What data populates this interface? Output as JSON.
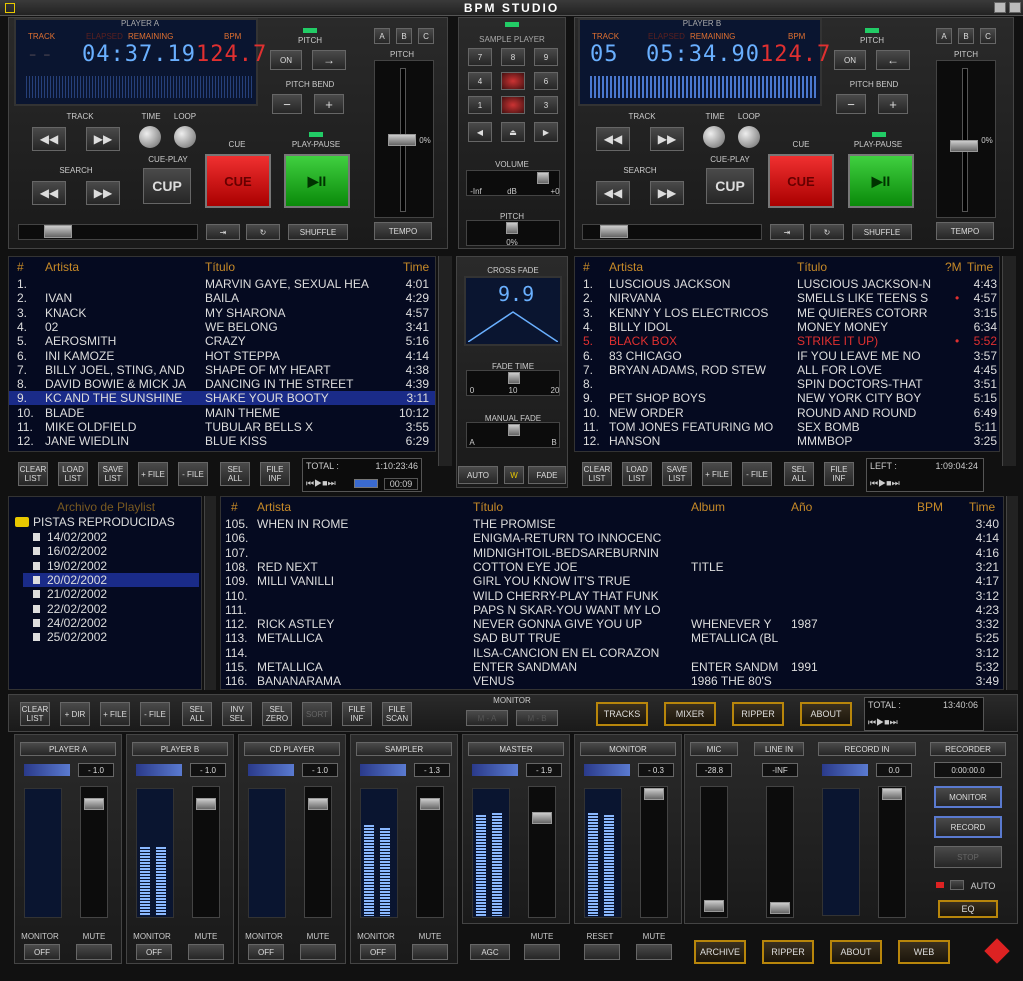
{
  "app": {
    "title": "BPM STUDIO"
  },
  "deckA": {
    "label": "PLAYER A",
    "track_lbl": "TRACK",
    "elapsed_lbl": "ELAPSED",
    "remaining_lbl": "REMAINING",
    "bpm_lbl": "BPM",
    "track_num": "--",
    "time": "04:37.19",
    "bpm": "124.7",
    "pitch_lbl": "PITCH",
    "on": "ON",
    "arrow": "→",
    "pitchbend_lbl": "PITCH BEND",
    "minus": "−",
    "plus": "+",
    "track": "TRACK",
    "time_lbl": "TIME",
    "loop_lbl": "LOOP",
    "search": "SEARCH",
    "cueplay": "CUE-PLAY",
    "cup": "CUP",
    "cue_lbl": "CUE",
    "cue": "CUE",
    "playpause_lbl": "PLAY-PAUSE",
    "playpause": "▶II",
    "pitch_pct": "0%",
    "shuffle": "SHUFFLE",
    "tempo": "TEMPO",
    "a": "A",
    "b": "B",
    "c": "C",
    "pitch_head": "PITCH"
  },
  "deckB": {
    "label": "PLAYER B",
    "track_lbl": "TRACK",
    "elapsed_lbl": "ELAPSED",
    "remaining_lbl": "REMAINING",
    "bpm_lbl": "BPM",
    "track_num": "05",
    "time": "05:34.90",
    "bpm": "124.7",
    "pitch_lbl": "PITCH",
    "on": "ON",
    "arrow": "←",
    "pitchbend_lbl": "PITCH BEND",
    "minus": "−",
    "plus": "+",
    "track": "TRACK",
    "time_lbl": "TIME",
    "loop_lbl": "LOOP",
    "search": "SEARCH",
    "cueplay": "CUE-PLAY",
    "cup": "CUP",
    "cue_lbl": "CUE",
    "cue": "CUE",
    "playpause_lbl": "PLAY-PAUSE",
    "playpause": "▶II",
    "pitch_pct": "0%",
    "shuffle": "SHUFFLE",
    "tempo": "TEMPO",
    "a": "A",
    "b": "B",
    "c": "C",
    "pitch_head": "PITCH"
  },
  "sampler": {
    "label": "SAMPLE PLAYER",
    "pads": [
      "7",
      "8",
      "9",
      "4",
      "",
      "6",
      "1",
      "",
      "3"
    ],
    "volume": "VOLUME",
    "inf": "-Inf",
    "db": "dB",
    "zero": "+0",
    "pitch": "PITCH",
    "pct": "0%"
  },
  "crossfade": {
    "label": "CROSS FADE",
    "value": "9.9",
    "fadetime": "FADE TIME",
    "t0": "0",
    "t10": "10",
    "t20": "20",
    "manual": "MANUAL FADE",
    "a": "A",
    "b": "B",
    "auto": "AUTO",
    "w": "W",
    "fade": "FADE"
  },
  "listA": {
    "cols": [
      "#",
      "Artista",
      "Título",
      "Time"
    ],
    "rows": [
      [
        "1.",
        "",
        "MARVIN GAYE, SEXUAL HEA",
        "4:01"
      ],
      [
        "2.",
        "IVAN",
        "BAILA",
        "4:29"
      ],
      [
        "3.",
        "KNACK",
        "MY SHARONA",
        "4:57"
      ],
      [
        "4.",
        "02",
        "WE BELONG",
        "3:41"
      ],
      [
        "5.",
        "AEROSMITH",
        "CRAZY",
        "5:16"
      ],
      [
        "6.",
        "INI KAMOZE",
        "HOT STEPPA",
        "4:14"
      ],
      [
        "7.",
        "BILLY JOEL, STING, AND",
        "SHAPE OF MY HEART",
        "4:38"
      ],
      [
        "8.",
        "DAVID BOWIE & MICK JA",
        "DANCING IN THE STREET",
        "4:39"
      ],
      [
        "9.",
        "KC AND THE SUNSHINE",
        "SHAKE YOUR BOOTY",
        "3:11"
      ],
      [
        "10.",
        "BLADE",
        "MAIN THEME",
        "10:12"
      ],
      [
        "11.",
        "MIKE OLDFIELD",
        "TUBULAR BELLS X",
        "3:55"
      ],
      [
        "12.",
        "JANE WIEDLIN",
        "BLUE KISS",
        "6:29"
      ]
    ],
    "total_lbl": "TOTAL :",
    "total": "1:10:23:46",
    "pos": "00:09"
  },
  "listB": {
    "cols": [
      "#",
      "Artista",
      "Título",
      "?M",
      "Time"
    ],
    "rows": [
      [
        "1.",
        "LUSCIOUS JACKSON",
        "LUSCIOUS JACKSON-N",
        "",
        "4:43"
      ],
      [
        "2.",
        "NIRVANA",
        "SMELLS LIKE TEENS S",
        "•",
        "4:57"
      ],
      [
        "3.",
        "KENNY Y LOS ELECTRICOS",
        "ME QUIERES COTORR",
        "",
        "3:15"
      ],
      [
        "4.",
        "BILLY IDOL",
        "MONEY MONEY",
        "",
        "6:34"
      ],
      [
        "5.",
        "BLACK BOX",
        "STRIKE IT UP)",
        "•",
        "5:52"
      ],
      [
        "6.",
        "83 CHICAGO",
        "IF YOU LEAVE ME NO",
        "",
        "3:57"
      ],
      [
        "7.",
        "BRYAN ADAMS, ROD STEW",
        "ALL FOR LOVE",
        "",
        "4:45"
      ],
      [
        "8.",
        "",
        "SPIN DOCTORS-THAT",
        "",
        "3:51"
      ],
      [
        "9.",
        "PET SHOP BOYS",
        "NEW YORK CITY BOY",
        "",
        "5:15"
      ],
      [
        "10.",
        "NEW ORDER",
        "ROUND AND ROUND",
        "",
        "6:49"
      ],
      [
        "11.",
        "TOM JONES FEATURING MO",
        "SEX BOMB",
        "",
        "5:11"
      ],
      [
        "12.",
        "HANSON",
        "MMMBOP",
        "",
        "3:25"
      ]
    ],
    "left_lbl": "LEFT :",
    "left": "1:09:04:24"
  },
  "listbtns": {
    "clear": "CLEAR LIST",
    "load": "LOAD LIST",
    "save": "SAVE LIST",
    "addfile": "+ FILE",
    "remfile": "- FILE",
    "selall": "SEL ALL",
    "fileinf": "FILE INF"
  },
  "archive": {
    "title": "Archivo de Playlist",
    "root": "PISTAS REPRODUCIDAS",
    "dates": [
      "14/02/2002",
      "16/02/2002",
      "19/02/2002",
      "20/02/2002",
      "21/02/2002",
      "22/02/2002",
      "24/02/2002",
      "25/02/2002"
    ]
  },
  "main": {
    "cols": [
      "#",
      "Artista",
      "Título",
      "Album",
      "Año",
      "BPM",
      "Time"
    ],
    "rows": [
      [
        "105.",
        "WHEN IN ROME",
        "THE PROMISE",
        "",
        "",
        "",
        "3:40"
      ],
      [
        "106.",
        "",
        "ENIGMA-RETURN TO INNOCENC",
        "",
        "",
        "",
        "4:14"
      ],
      [
        "107.",
        "",
        "MIDNIGHTOIL-BEDSAREBURNIN",
        "",
        "",
        "",
        "4:16"
      ],
      [
        "108.",
        "RED NEXT",
        "COTTON EYE JOE",
        "TITLE",
        "",
        "",
        "3:21"
      ],
      [
        "109.",
        "MILLI VANILLI",
        "GIRL YOU KNOW IT'S TRUE",
        "",
        "",
        "",
        "4:17"
      ],
      [
        "110.",
        "",
        "WILD CHERRY-PLAY THAT FUNK",
        "",
        "",
        "",
        "3:12"
      ],
      [
        "111.",
        "",
        "PAPS N SKAR-YOU WANT MY LO",
        "",
        "",
        "",
        "4:23"
      ],
      [
        "112.",
        "RICK ASTLEY",
        "NEVER GONNA GIVE YOU UP",
        "WHENEVER Y",
        "1987",
        "",
        "3:32"
      ],
      [
        "113.",
        "METALLICA",
        "SAD BUT TRUE",
        "METALLICA (BL",
        "",
        "",
        "5:25"
      ],
      [
        "114.",
        "",
        "ILSA-CANCION EN EL CORAZON",
        "",
        "",
        "",
        "3:12"
      ],
      [
        "115.",
        "METALLICA",
        "ENTER SANDMAN",
        "ENTER SANDM",
        "1991",
        "",
        "5:32"
      ],
      [
        "116.",
        "BANANARAMA",
        "VENUS",
        "1986 THE 80'S",
        "",
        "",
        "3:49"
      ]
    ]
  },
  "bottombar": {
    "clear": "CLEAR LIST",
    "dir": "+ DIR",
    "file": "+ FILE",
    "remfile": "- FILE",
    "selall": "SEL ALL",
    "invsel": "INV SEL",
    "selzero": "SEL ZERO",
    "sort": "SORT",
    "fileinf": "FILE INF",
    "filescan": "FILE SCAN",
    "monitor": "MONITOR",
    "ma": "M - A",
    "mb": "M - B",
    "tracks": "TRACKS",
    "mixer": "MIXER",
    "ripper": "RIPPER",
    "about": "ABOUT",
    "total_lbl": "TOTAL :",
    "total": "13:40:06"
  },
  "mixer": {
    "channels": [
      {
        "name": "PLAYER A",
        "db": "- 1.0",
        "b1": "MONITOR",
        "b2": "MUTE",
        "off": "OFF"
      },
      {
        "name": "PLAYER B",
        "db": "- 1.0",
        "b1": "MONITOR",
        "b2": "MUTE",
        "off": "OFF"
      },
      {
        "name": "CD PLAYER",
        "db": "- 1.0",
        "b1": "MONITOR",
        "b2": "MUTE",
        "off": "OFF"
      },
      {
        "name": "SAMPLER",
        "db": "- 1.3",
        "b1": "MONITOR",
        "b2": "MUTE",
        "off": "OFF"
      },
      {
        "name": "MASTER",
        "db": "- 1.9",
        "b1": "",
        "b2": "MUTE",
        "off": ""
      },
      {
        "name": "MONITOR",
        "db": "- 0.3",
        "b1": "RESET",
        "b2": "MUTE",
        "off": ""
      }
    ],
    "agc": "AGC",
    "mic": "MIC",
    "mic_db": "-28.8",
    "linein": "LINE IN",
    "linein_db": "-INF",
    "recin": "RECORD IN",
    "recin_db": "0.0",
    "recorder": "RECORDER",
    "rec_time": "0:00:00.0",
    "monitor": "MONITOR",
    "record": "RECORD",
    "stop": "STOP",
    "auto": "AUTO",
    "eq": "EQ",
    "archive": "ARCHIVE",
    "ripper": "RIPPER",
    "about": "ABOUT",
    "web": "WEB"
  }
}
